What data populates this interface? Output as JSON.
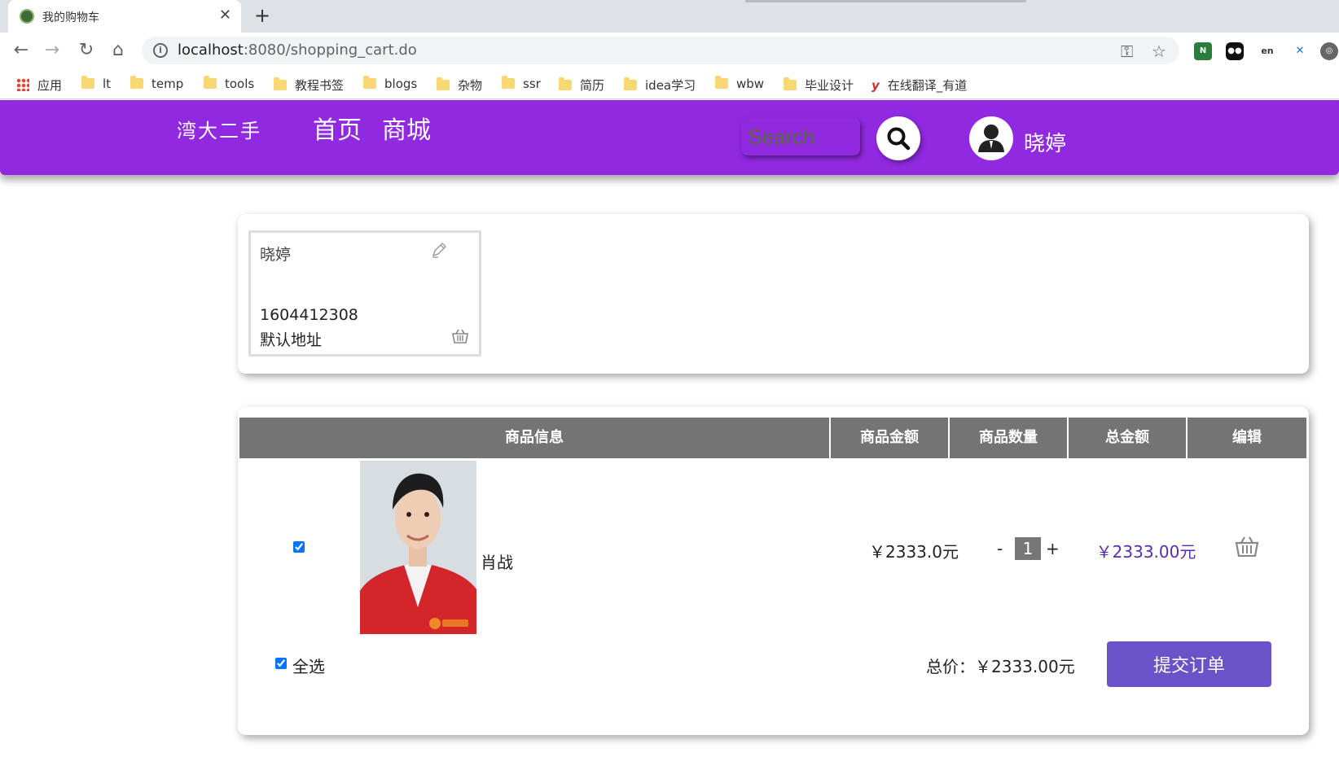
{
  "browser": {
    "tab_title": "我的购物车",
    "tab_close": "✕",
    "new_tab": "+",
    "url_host": "localhost",
    "url_path": ":8080/shopping_cart.do",
    "back": "←",
    "forward": "→",
    "reload": "↻",
    "home": "⌂",
    "key": "⚿",
    "star": "☆",
    "info": "i"
  },
  "bookmarks": {
    "apps": "应用",
    "items": [
      "lt",
      "temp",
      "tools",
      "教程书签",
      "blogs",
      "杂物",
      "ssr",
      "简历",
      "idea学习",
      "wbw",
      "毕业设计"
    ],
    "youdao_mark": "y",
    "youdao": "在线翻译_有道"
  },
  "header": {
    "brand": "湾大二手",
    "nav": [
      "首页",
      "商城"
    ],
    "search_placeholder": "Search",
    "username": "晓婷"
  },
  "address": {
    "name": "晓婷",
    "phone": "1604412308",
    "label": "默认地址"
  },
  "cart": {
    "columns": [
      "商品信息",
      "商品金额",
      "商品数量",
      "总金额",
      "编辑"
    ],
    "item": {
      "name": "肖战",
      "price": "￥2333.0元",
      "qty_minus": "-",
      "quantity": "1",
      "qty_plus": "+",
      "subtotal": "￥2333.00元",
      "checked": true
    },
    "select_all": "全选",
    "total": "总价：￥2333.00元",
    "submit": "提交订单"
  },
  "colors": {
    "header_bg": "#9029e0",
    "table_header": "#747474",
    "submit_bg": "#6a53c9",
    "subtotal_text": "#5a2ab6"
  }
}
